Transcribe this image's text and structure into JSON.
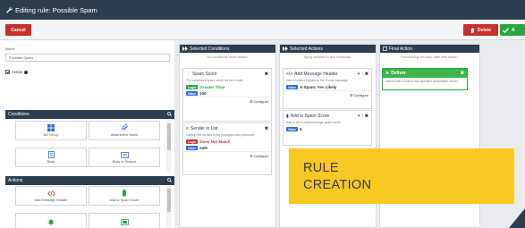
{
  "title": "Editing rule: Possible Spam",
  "toolbar": {
    "cancel": "Cancel",
    "delete": "Delete",
    "save": "A"
  },
  "rule": {
    "name_label": "Name",
    "name_value": "Possible Spam",
    "active_label": "Active"
  },
  "conditions": {
    "heading": "Conditions",
    "tiles": [
      "AD Group",
      "Attachment Name",
      "Body",
      "Body or Subject"
    ]
  },
  "actions": {
    "heading": "Actions",
    "tiles": [
      "Add Message Header",
      "Add to Spam Score",
      "",
      ""
    ]
  },
  "selected_conditions": {
    "heading": "Selected Conditions",
    "sub": "All conditions must match.",
    "cards": [
      {
        "title": "Spam Score",
        "desc": "The calculated spam score for the e-mail",
        "logic_tag": "Logic",
        "logic_value": "Greater Than",
        "value_tag": "Value",
        "value": "100",
        "configure": "Configure"
      },
      {
        "title": "Sender in List",
        "desc": "Lookup the sender in list (company and personal)",
        "logic_tag": "Logic",
        "logic_value": "Does Not Match",
        "value_tag": "Value",
        "value": "safe",
        "configure": "Configure"
      }
    ]
  },
  "selected_actions": {
    "heading": "Selected Actions",
    "sub": "Apply actions to this message.",
    "cards": [
      {
        "title": "Add Message Header",
        "controls": "+ ↑ ✖",
        "desc": "Add a custom header to the e-mail message",
        "value_tag": "Value",
        "value": "X-Spam: Yes Likely",
        "configure": "Configure"
      },
      {
        "title": "Add to Spam Score",
        "controls": "+ ↑ ✖",
        "desc": "Add to the e-mail message spam score",
        "value_tag": "Value",
        "value": "5",
        "configure": ""
      }
    ]
  },
  "final_action": {
    "heading": "Final Action",
    "sub": "Processing will stop after this action.",
    "card_title": "Deliver",
    "card_desc": "Deliver this e-mail to the specified destination server"
  },
  "overlay": {
    "line1": "RULE",
    "line2": "CREATION"
  },
  "colors": {
    "header": "#2c3e50",
    "danger": "#c9302c",
    "success": "#28a745",
    "overlay": "#f9c922",
    "value_tag": "#2d6cdf"
  }
}
